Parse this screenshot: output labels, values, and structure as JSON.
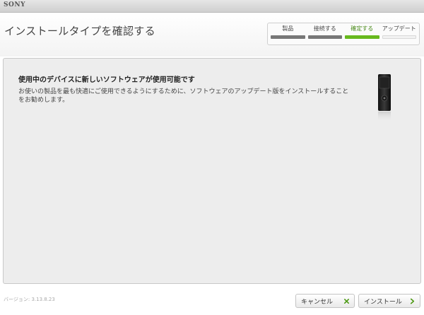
{
  "app": {
    "brand": "SONY"
  },
  "header": {
    "title": "インストールタイプを確認する"
  },
  "steps": [
    {
      "label": "製品",
      "state": "done"
    },
    {
      "label": "接続する",
      "state": "done"
    },
    {
      "label": "確定する",
      "state": "active"
    },
    {
      "label": "アップデート",
      "state": "pending"
    }
  ],
  "panel": {
    "heading": "使用中のデバイスに新しいソフトウェアが使用可能です",
    "body": "お使いの製品を最も快適にご使用できるようにするために、ソフトウェアのアップデート版をインストールすることをお勧めします。"
  },
  "footer": {
    "version": "バージョン: 3.13.8.23",
    "cancel_label": "キャンセル",
    "install_label": "インストール"
  },
  "colors": {
    "accent_green": "#67b91d",
    "cancel_icon": "#4e9a16",
    "install_icon": "#4e9a16"
  },
  "icons": {
    "cancel": "close-icon",
    "install": "chevron-right-icon",
    "device": "walkman-device-icon"
  }
}
